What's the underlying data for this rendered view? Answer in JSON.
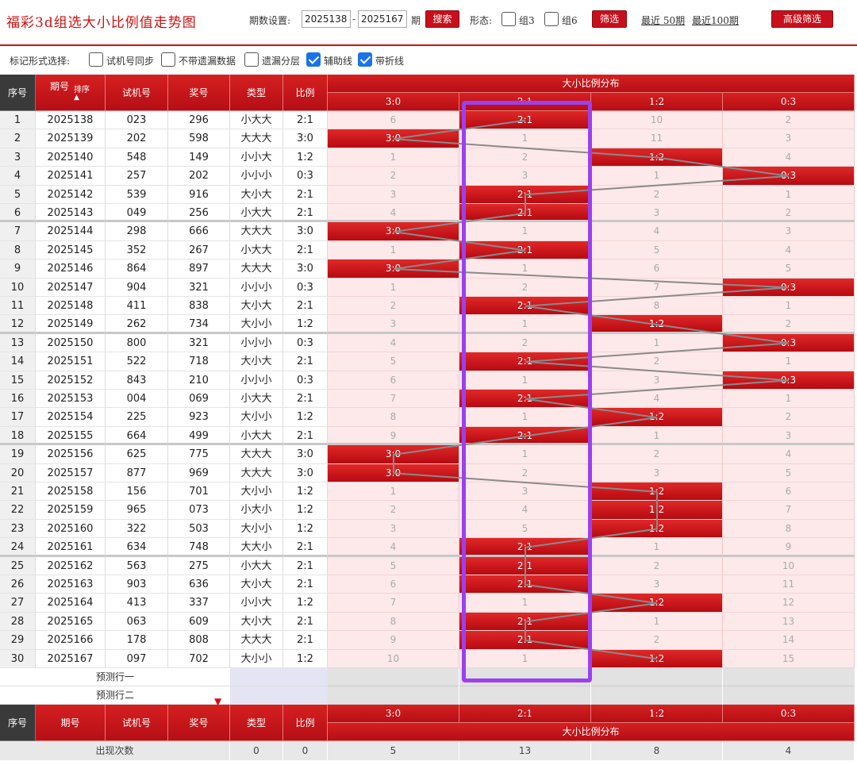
{
  "header": {
    "title": "福彩3d组选大小比例值走势图",
    "period_label": "期数设置:",
    "period_from": "2025138",
    "period_dash": "-",
    "period_to": "2025167",
    "period_suffix": "期",
    "search_label": "搜索",
    "form_label": "形态:",
    "group3_label": "组3",
    "group6_label": "组6",
    "filter_label": "筛选",
    "recent50_label": "最近 50期",
    "recent100_label": "最近100期",
    "advanced_label": "高级筛选"
  },
  "markers": {
    "label": "标记形式选择:",
    "options": [
      {
        "label": "试机号同步",
        "checked": false
      },
      {
        "label": "不带遗漏数据",
        "checked": false
      },
      {
        "label": "遗漏分层",
        "checked": false
      },
      {
        "label": "辅助线",
        "checked": true
      },
      {
        "label": "带折线",
        "checked": true
      }
    ]
  },
  "table": {
    "headers": {
      "seq": "序号",
      "period": "期号",
      "sort": "排序",
      "test_no": "试机号",
      "prize_no": "奖号",
      "type": "类型",
      "ratio": "比例",
      "distribution": "大小比例分布"
    },
    "zones": [
      "3:0",
      "2:1",
      "1:2",
      "0:3"
    ],
    "rows": [
      {
        "seq": "1",
        "period": "2025138",
        "test": "023",
        "prize": "296",
        "type": "小大大",
        "ratio": "2:1",
        "zones": [
          "6",
          "2:1",
          "10",
          "2"
        ]
      },
      {
        "seq": "2",
        "period": "2025139",
        "test": "202",
        "prize": "598",
        "type": "大大大",
        "ratio": "3:0",
        "zones": [
          "3:0",
          "1",
          "11",
          "3"
        ]
      },
      {
        "seq": "3",
        "period": "2025140",
        "test": "548",
        "prize": "149",
        "type": "小小大",
        "ratio": "1:2",
        "zones": [
          "1",
          "2",
          "1:2",
          "4"
        ]
      },
      {
        "seq": "4",
        "period": "2025141",
        "test": "257",
        "prize": "202",
        "type": "小小小",
        "ratio": "0:3",
        "zones": [
          "2",
          "3",
          "1",
          "0:3"
        ]
      },
      {
        "seq": "5",
        "period": "2025142",
        "test": "539",
        "prize": "916",
        "type": "大小大",
        "ratio": "2:1",
        "zones": [
          "3",
          "2:1",
          "2",
          "1"
        ]
      },
      {
        "seq": "6",
        "period": "2025143",
        "test": "049",
        "prize": "256",
        "type": "小大大",
        "ratio": "2:1",
        "zones": [
          "4",
          "2:1",
          "3",
          "2"
        ]
      },
      {
        "seq": "7",
        "period": "2025144",
        "test": "298",
        "prize": "666",
        "type": "大大大",
        "ratio": "3:0",
        "zones": [
          "3:0",
          "1",
          "4",
          "3"
        ]
      },
      {
        "seq": "8",
        "period": "2025145",
        "test": "352",
        "prize": "267",
        "type": "小大大",
        "ratio": "2:1",
        "zones": [
          "1",
          "2:1",
          "5",
          "4"
        ]
      },
      {
        "seq": "9",
        "period": "2025146",
        "test": "864",
        "prize": "897",
        "type": "大大大",
        "ratio": "3:0",
        "zones": [
          "3:0",
          "1",
          "6",
          "5"
        ]
      },
      {
        "seq": "10",
        "period": "2025147",
        "test": "904",
        "prize": "321",
        "type": "小小小",
        "ratio": "0:3",
        "zones": [
          "1",
          "2",
          "7",
          "0:3"
        ]
      },
      {
        "seq": "11",
        "period": "2025148",
        "test": "411",
        "prize": "838",
        "type": "大小大",
        "ratio": "2:1",
        "zones": [
          "2",
          "2:1",
          "8",
          "1"
        ]
      },
      {
        "seq": "12",
        "period": "2025149",
        "test": "262",
        "prize": "734",
        "type": "大小小",
        "ratio": "1:2",
        "zones": [
          "3",
          "1",
          "1:2",
          "2"
        ]
      },
      {
        "seq": "13",
        "period": "2025150",
        "test": "800",
        "prize": "321",
        "type": "小小小",
        "ratio": "0:3",
        "zones": [
          "4",
          "2",
          "1",
          "0:3"
        ]
      },
      {
        "seq": "14",
        "period": "2025151",
        "test": "522",
        "prize": "718",
        "type": "大小大",
        "ratio": "2:1",
        "zones": [
          "5",
          "2:1",
          "2",
          "1"
        ]
      },
      {
        "seq": "15",
        "period": "2025152",
        "test": "843",
        "prize": "210",
        "type": "小小小",
        "ratio": "0:3",
        "zones": [
          "6",
          "1",
          "3",
          "0:3"
        ]
      },
      {
        "seq": "16",
        "period": "2025153",
        "test": "004",
        "prize": "069",
        "type": "小大大",
        "ratio": "2:1",
        "zones": [
          "7",
          "2:1",
          "4",
          "1"
        ]
      },
      {
        "seq": "17",
        "period": "2025154",
        "test": "225",
        "prize": "923",
        "type": "大小小",
        "ratio": "1:2",
        "zones": [
          "8",
          "1",
          "1:2",
          "2"
        ]
      },
      {
        "seq": "18",
        "period": "2025155",
        "test": "664",
        "prize": "499",
        "type": "小大大",
        "ratio": "2:1",
        "zones": [
          "9",
          "2:1",
          "1",
          "3"
        ]
      },
      {
        "seq": "19",
        "period": "2025156",
        "test": "625",
        "prize": "775",
        "type": "大大大",
        "ratio": "3:0",
        "zones": [
          "3:0",
          "1",
          "2",
          "4"
        ]
      },
      {
        "seq": "20",
        "period": "2025157",
        "test": "877",
        "prize": "969",
        "type": "大大大",
        "ratio": "3:0",
        "zones": [
          "3:0",
          "2",
          "3",
          "5"
        ]
      },
      {
        "seq": "21",
        "period": "2025158",
        "test": "156",
        "prize": "701",
        "type": "大小小",
        "ratio": "1:2",
        "zones": [
          "1",
          "3",
          "1:2",
          "6"
        ]
      },
      {
        "seq": "22",
        "period": "2025159",
        "test": "965",
        "prize": "073",
        "type": "小大小",
        "ratio": "1:2",
        "zones": [
          "2",
          "4",
          "1:2",
          "7"
        ]
      },
      {
        "seq": "23",
        "period": "2025160",
        "test": "322",
        "prize": "503",
        "type": "大小小",
        "ratio": "1:2",
        "zones": [
          "3",
          "5",
          "1:2",
          "8"
        ]
      },
      {
        "seq": "24",
        "period": "2025161",
        "test": "634",
        "prize": "748",
        "type": "大大小",
        "ratio": "2:1",
        "zones": [
          "4",
          "2:1",
          "1",
          "9"
        ]
      },
      {
        "seq": "25",
        "period": "2025162",
        "test": "563",
        "prize": "275",
        "type": "小大大",
        "ratio": "2:1",
        "zones": [
          "5",
          "2:1",
          "2",
          "10"
        ]
      },
      {
        "seq": "26",
        "period": "2025163",
        "test": "903",
        "prize": "636",
        "type": "大小大",
        "ratio": "2:1",
        "zones": [
          "6",
          "2:1",
          "3",
          "11"
        ]
      },
      {
        "seq": "27",
        "period": "2025164",
        "test": "413",
        "prize": "337",
        "type": "小小大",
        "ratio": "1:2",
        "zones": [
          "7",
          "1",
          "1:2",
          "12"
        ]
      },
      {
        "seq": "28",
        "period": "2025165",
        "test": "063",
        "prize": "609",
        "type": "大小大",
        "ratio": "2:1",
        "zones": [
          "8",
          "2:1",
          "1",
          "13"
        ]
      },
      {
        "seq": "29",
        "period": "2025166",
        "test": "178",
        "prize": "808",
        "type": "大大大",
        "ratio": "2:1",
        "zones": [
          "9",
          "2:1",
          "2",
          "14"
        ]
      },
      {
        "seq": "30",
        "period": "2025167",
        "test": "097",
        "prize": "702",
        "type": "大小小",
        "ratio": "1:2",
        "zones": [
          "10",
          "1",
          "1:2",
          "15"
        ]
      }
    ],
    "hit_zone_index": [
      1,
      0,
      2,
      3,
      1,
      1,
      0,
      1,
      0,
      3,
      1,
      2,
      3,
      1,
      3,
      1,
      2,
      1,
      0,
      0,
      2,
      2,
      2,
      1,
      1,
      1,
      2,
      1,
      1,
      2
    ],
    "predict_rows": [
      "预测行一",
      "预测行二"
    ],
    "footer_headers": {
      "seq": "序号",
      "period": "期号",
      "test_no": "试机号",
      "prize_no": "奖号",
      "type": "类型",
      "ratio": "比例",
      "distribution": "大小比例分布"
    },
    "stats": {
      "label": "出现次数",
      "type": "0",
      "ratio": "0",
      "zones": [
        "5",
        "13",
        "8",
        "4"
      ]
    }
  },
  "colors": {
    "brand_red": "#d01010",
    "highlight_box": "#9b40f0",
    "checked_blue": "#1a73e8"
  }
}
